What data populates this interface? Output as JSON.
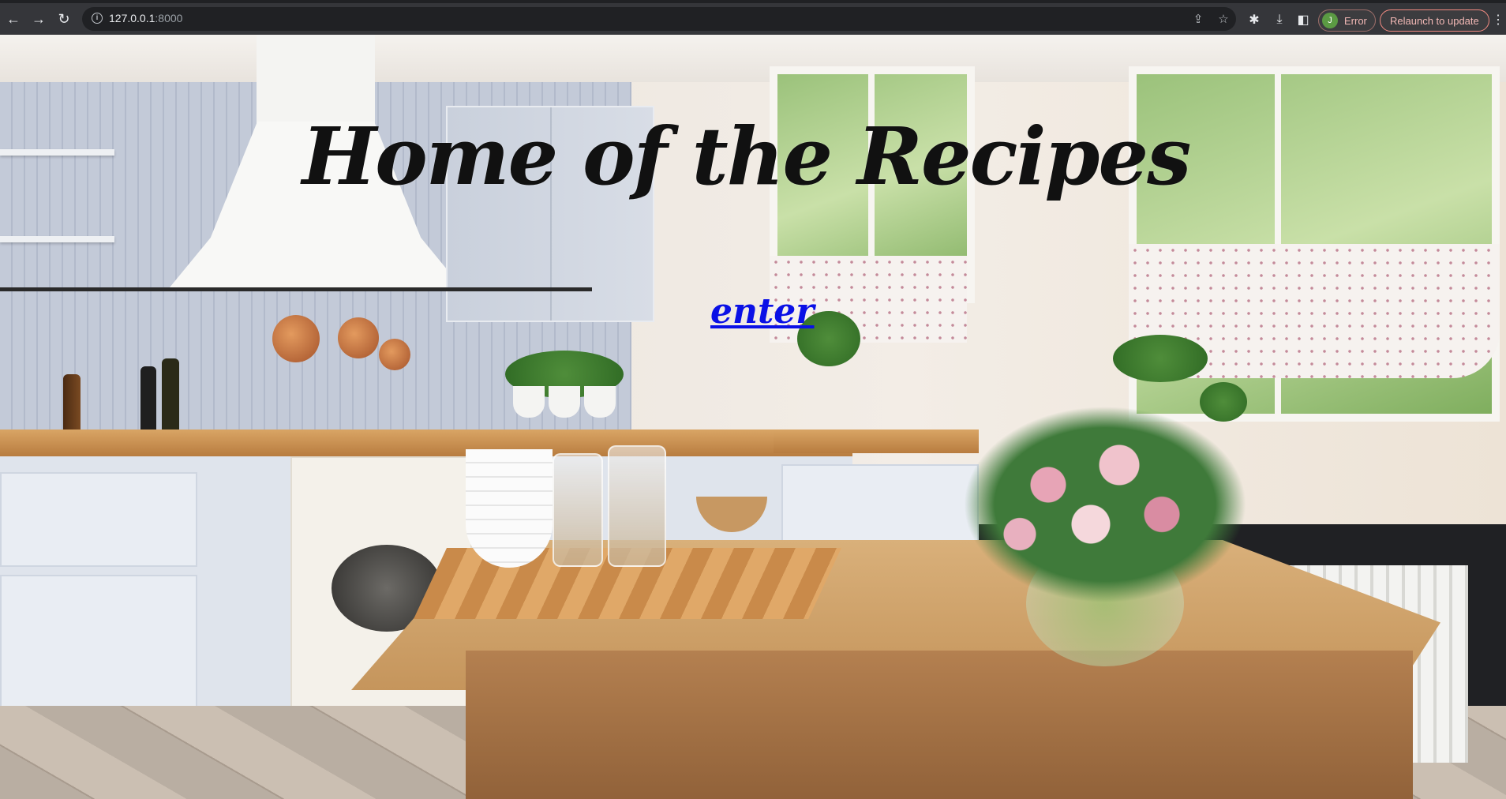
{
  "browser": {
    "url_host": "127.0.0.1",
    "url_port": ":8000",
    "profile_initial": "J",
    "profile_status": "Error",
    "relaunch_label": "Relaunch to update"
  },
  "page": {
    "title": "Home of the Recipes",
    "enter_link": "enter"
  },
  "colors": {
    "link": "#0a10e6",
    "title": "#111111"
  }
}
